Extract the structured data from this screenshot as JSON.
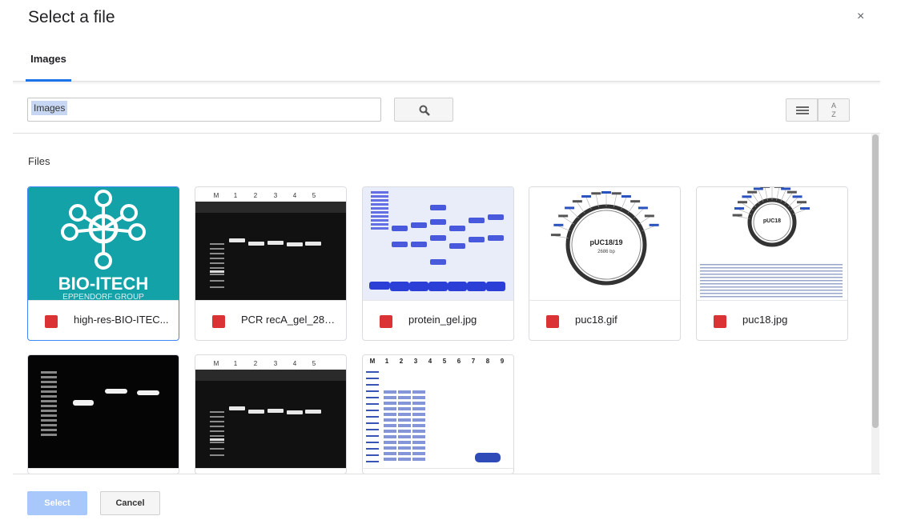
{
  "dialog": {
    "title": "Select a file",
    "close_icon": "close-icon",
    "close_glyph": "×"
  },
  "tabs": [
    {
      "label": "Images",
      "active": true
    }
  ],
  "search": {
    "value": "Images",
    "button_icon": "search-icon"
  },
  "view_toggle": {
    "list_icon": "list-view-icon",
    "sort_icon": "sort-az-icon",
    "sort_glyph_top": "A",
    "sort_glyph_bottom": "Z"
  },
  "section": {
    "label": "Files"
  },
  "files": [
    {
      "name": "high-res-BIO-ITEC...",
      "icon": "image-file-icon",
      "thumb": "logo",
      "selected": true
    },
    {
      "name": "PCR recA_gel_280...",
      "icon": "image-file-icon",
      "thumb": "gel",
      "selected": false
    },
    {
      "name": "protein_gel.jpg",
      "icon": "image-file-icon",
      "thumb": "protein",
      "selected": false
    },
    {
      "name": "puc18.gif",
      "icon": "image-file-icon",
      "thumb": "plasmid",
      "selected": false
    },
    {
      "name": "puc18.jpg",
      "icon": "image-file-icon",
      "thumb": "plasmid2",
      "selected": false
    },
    {
      "name": "",
      "icon": "image-file-icon",
      "thumb": "dna",
      "selected": false
    },
    {
      "name": "",
      "icon": "image-file-icon",
      "thumb": "gel",
      "selected": false
    },
    {
      "name": "",
      "icon": "image-file-icon",
      "thumb": "sds",
      "selected": false
    }
  ],
  "thumbnail_text": {
    "logo_name": "BIO-ITECH",
    "logo_sub": "EPPENDORF GROUP",
    "gel_lanes": [
      "M",
      "1",
      "2",
      "3",
      "4",
      "5"
    ],
    "plasmid_title": "pUC18/19",
    "plasmid_bp": "2686 bp",
    "plasmid2_title": "pUC18",
    "sds_lanes": [
      "M",
      "1",
      "2",
      "3",
      "4",
      "5",
      "6",
      "7",
      "8",
      "9"
    ]
  },
  "colors": {
    "accent": "#1a73e8",
    "logo_bg": "#12a2a8",
    "select_button": "#a8c7fa",
    "file_icon": "#db3236",
    "coomassie": "#2b3fd6"
  },
  "footer": {
    "select_label": "Select",
    "cancel_label": "Cancel"
  }
}
